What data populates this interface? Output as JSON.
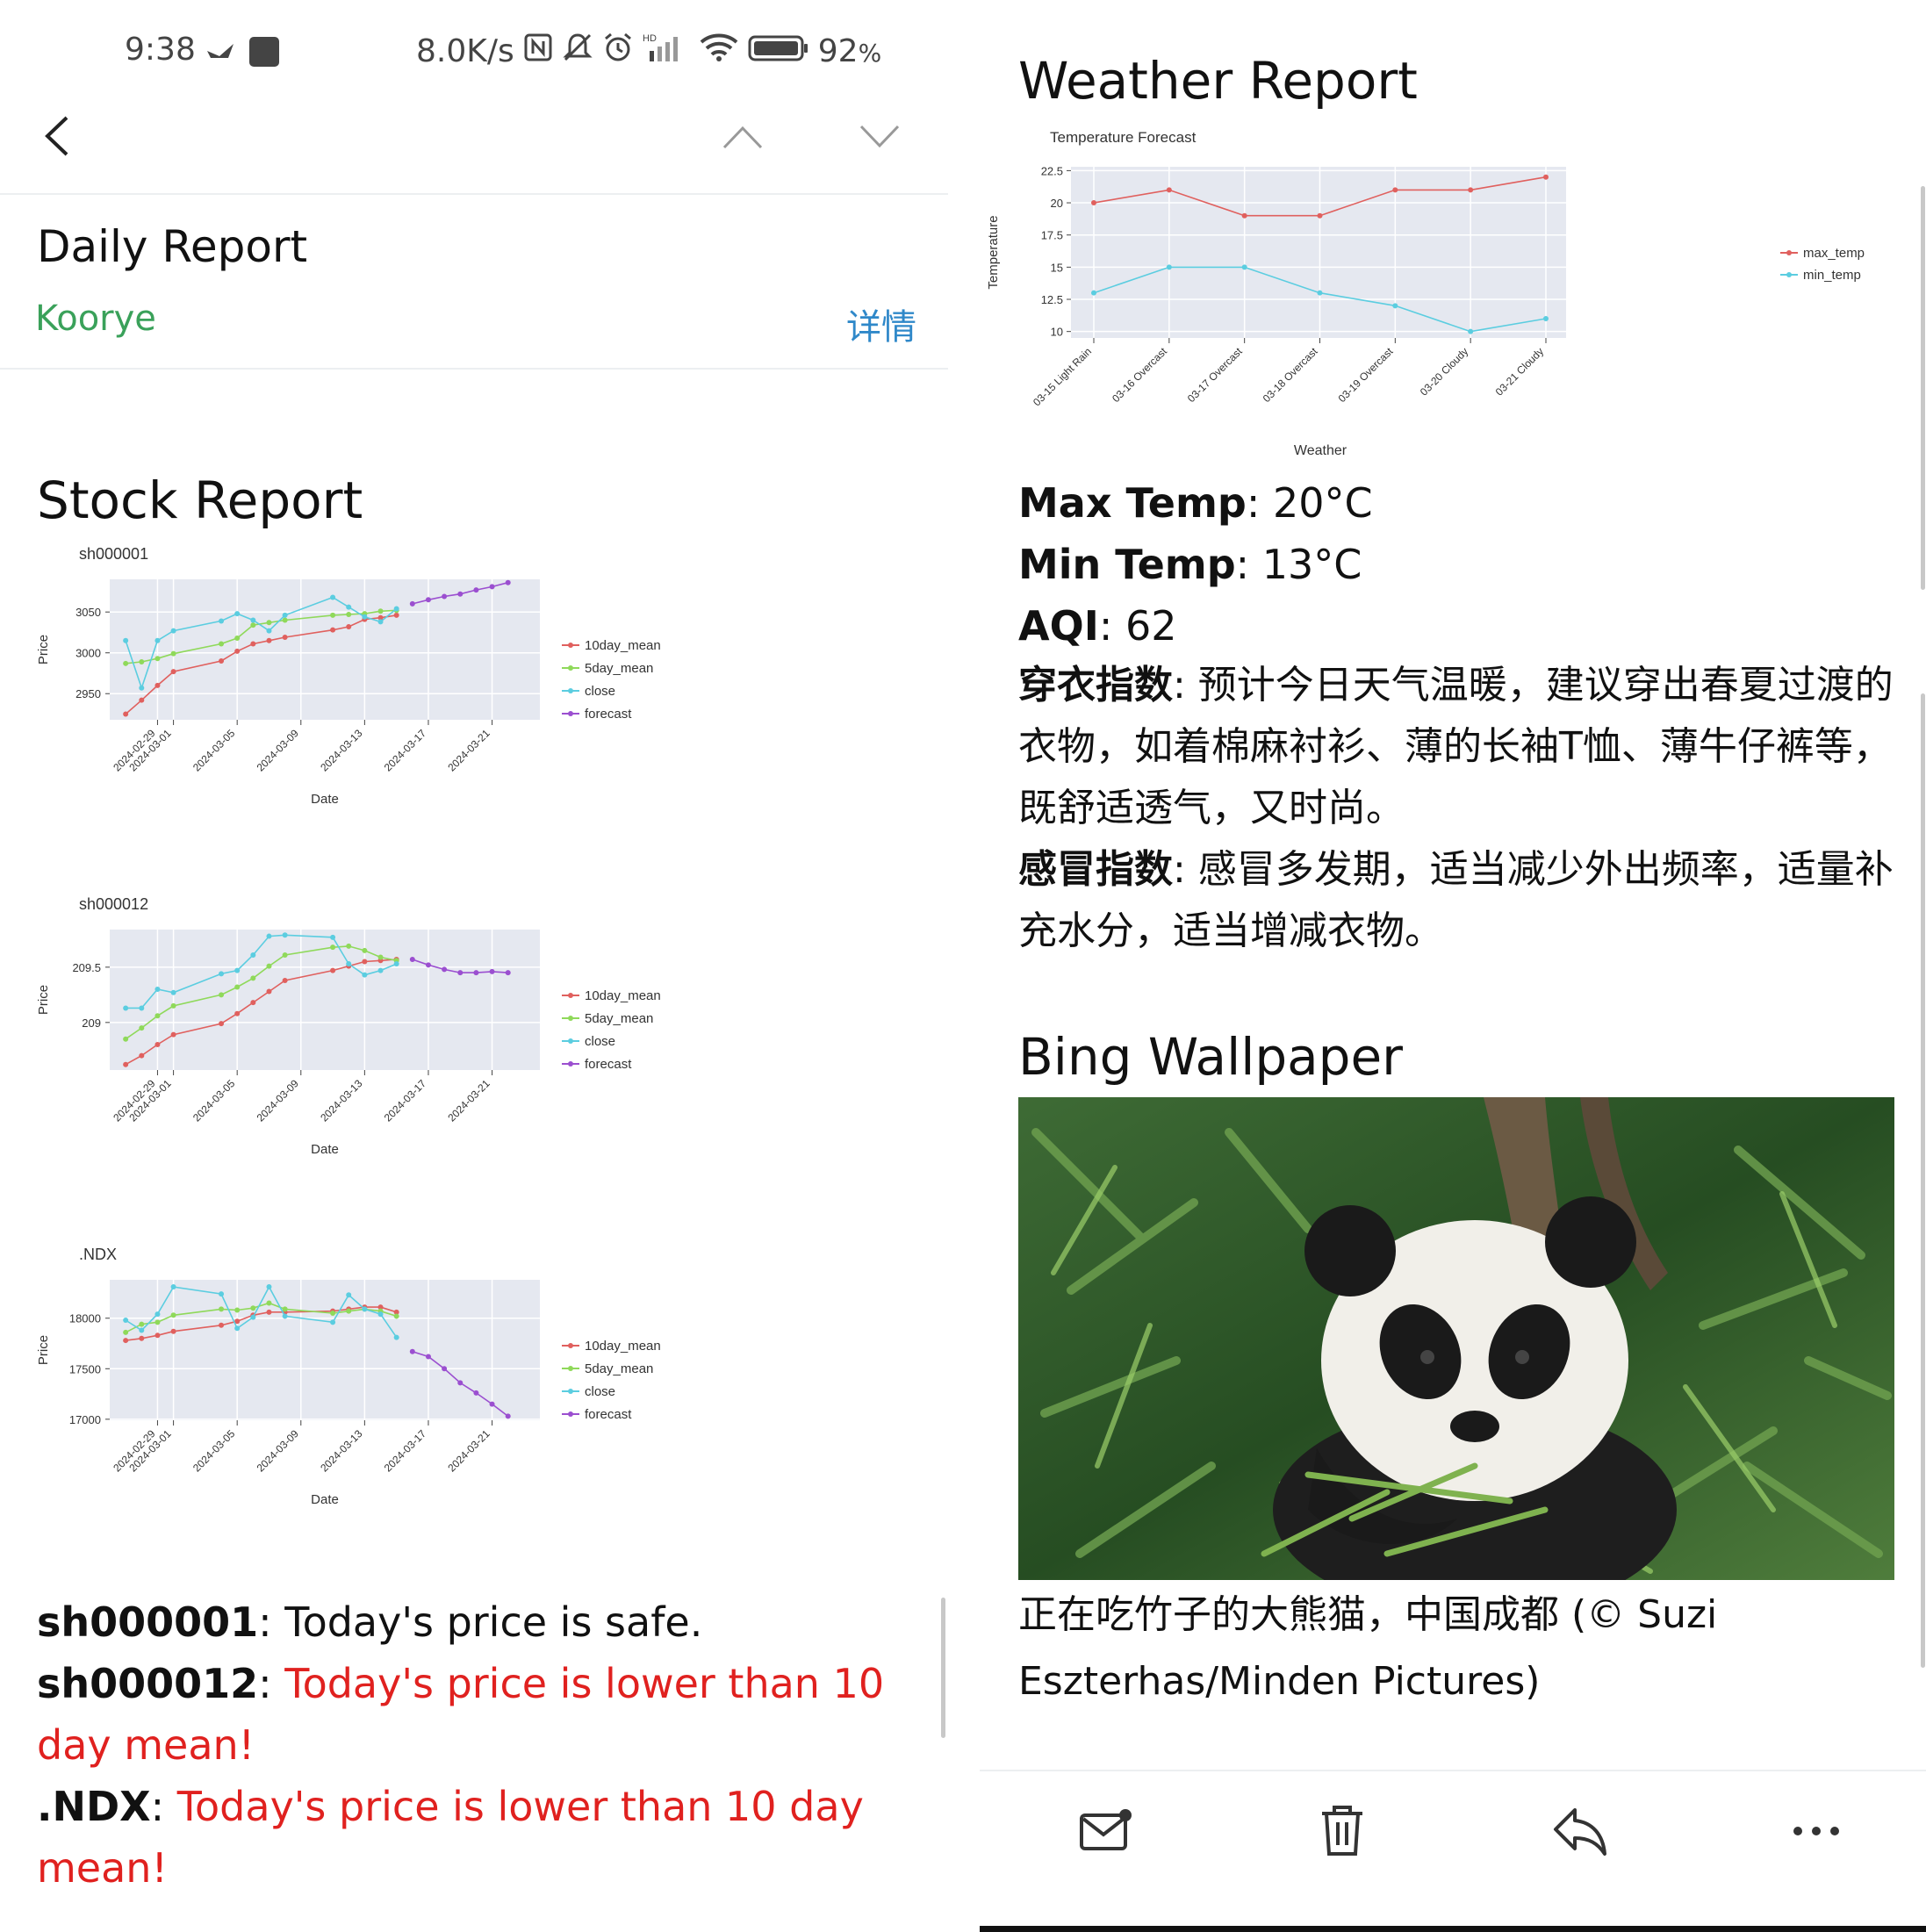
{
  "status_bar": {
    "time": "9:38",
    "speed": "8.0K/s",
    "battery": "92",
    "battery_unit": "%",
    "network": "HD"
  },
  "nav": {
    "back_icon": "chevron-left-icon",
    "prev_icon": "chevron-up-icon",
    "next_icon": "chevron-down-icon"
  },
  "mail": {
    "subject": "Daily Report",
    "sender": "Koorye",
    "details_link": "详情"
  },
  "stock": {
    "section_title": "Stock Report",
    "messages": [
      {
        "symbol": "sh000001",
        "text": "Today's price is safe.",
        "status": "safe"
      },
      {
        "symbol": "sh000012",
        "text": "Today's price is lower than 10 day mean!",
        "status": "warning"
      },
      {
        "symbol": ".NDX",
        "text": "Today's price is lower than 10 day mean!",
        "status": "warning"
      }
    ]
  },
  "weather": {
    "section_title": "Weather Report",
    "max_temp_label": "Max Temp",
    "max_temp_value": ": 20°C",
    "min_temp_label": "Min Temp",
    "min_temp_value": ": 13°C",
    "aqi_label": "AQI",
    "aqi_value": ": 62",
    "dress_label": "穿衣指数",
    "dress_text": ": 预计今日天气温暖，建议穿出春夏过渡的衣物，如着棉麻衬衫、薄的长袖T恤、薄牛仔裤等，既舒适透气，又时尚。",
    "cold_label": "感冒指数",
    "cold_text": ": 感冒多发期，适当减少外出频率，适量补充水分，适当增减衣物。"
  },
  "wallpaper": {
    "section_title": "Bing Wallpaper",
    "caption": "正在吃竹子的大熊猫，中国成都 (© Suzi Eszterhas/Minden Pictures)"
  },
  "toolbar": {
    "icons": [
      "mail-icon",
      "trash-icon",
      "reply-icon",
      "more-icon"
    ]
  },
  "colors": {
    "10day_mean": "#e0605e",
    "5day_mean": "#8fd95a",
    "close": "#5bcde0",
    "forecast": "#9b4fd0",
    "max_temp": "#e0605e",
    "min_temp": "#5bcde0",
    "plot_bg": "#e5e8f0",
    "warning": "#e0211f",
    "sender": "#3aa15a",
    "link": "#2f88c9"
  },
  "chart_data": [
    {
      "type": "line",
      "title": "sh000001",
      "xlabel": "Date",
      "ylabel": "Price",
      "x_ticks": [
        "2024-02-29",
        "2024-03-01",
        "2024-03-05",
        "2024-03-09",
        "2024-03-13",
        "2024-03-17",
        "2024-03-21"
      ],
      "y_ticks": [
        2950,
        3000,
        3050
      ],
      "xlim": [
        "2024-02-26",
        "2024-03-24"
      ],
      "ylim": [
        2918,
        3090
      ],
      "legend": "right",
      "series": [
        {
          "name": "10day_mean",
          "x": [
            "2024-02-27",
            "2024-02-28",
            "2024-02-29",
            "2024-03-01",
            "2024-03-04",
            "2024-03-05",
            "2024-03-06",
            "2024-03-07",
            "2024-03-08",
            "2024-03-11",
            "2024-03-12",
            "2024-03-13",
            "2024-03-14",
            "2024-03-15"
          ],
          "y": [
            2925,
            2942,
            2960,
            2977,
            2990,
            3002,
            3011,
            3015,
            3019,
            3028,
            3032,
            3041,
            3043,
            3046
          ]
        },
        {
          "name": "5day_mean",
          "x": [
            "2024-02-27",
            "2024-02-28",
            "2024-02-29",
            "2024-03-01",
            "2024-03-04",
            "2024-03-05",
            "2024-03-06",
            "2024-03-07",
            "2024-03-08",
            "2024-03-11",
            "2024-03-12",
            "2024-03-13",
            "2024-03-14",
            "2024-03-15"
          ],
          "y": [
            2987,
            2989,
            2993,
            2999,
            3011,
            3018,
            3034,
            3037,
            3040,
            3046,
            3047,
            3048,
            3051,
            3052
          ]
        },
        {
          "name": "close",
          "x": [
            "2024-02-27",
            "2024-02-28",
            "2024-02-29",
            "2024-03-01",
            "2024-03-04",
            "2024-03-05",
            "2024-03-06",
            "2024-03-07",
            "2024-03-08",
            "2024-03-11",
            "2024-03-12",
            "2024-03-13",
            "2024-03-14",
            "2024-03-15"
          ],
          "y": [
            3015,
            2957,
            3015,
            3027,
            3039,
            3048,
            3040,
            3027,
            3046,
            3068,
            3056,
            3044,
            3038,
            3054
          ]
        },
        {
          "name": "forecast",
          "x": [
            "2024-03-16",
            "2024-03-17",
            "2024-03-18",
            "2024-03-19",
            "2024-03-20",
            "2024-03-21",
            "2024-03-22"
          ],
          "y": [
            3060,
            3065,
            3069,
            3072,
            3077,
            3081,
            3086
          ]
        }
      ]
    },
    {
      "type": "line",
      "title": "sh000012",
      "xlabel": "Date",
      "ylabel": "Price",
      "x_ticks": [
        "2024-02-29",
        "2024-03-01",
        "2024-03-05",
        "2024-03-09",
        "2024-03-13",
        "2024-03-17",
        "2024-03-21"
      ],
      "y_ticks": [
        209,
        209.5
      ],
      "xlim": [
        "2024-02-26",
        "2024-03-24"
      ],
      "ylim": [
        208.57,
        209.84
      ],
      "legend": "right",
      "series": [
        {
          "name": "10day_mean",
          "x": [
            "2024-02-27",
            "2024-02-28",
            "2024-02-29",
            "2024-03-01",
            "2024-03-04",
            "2024-03-05",
            "2024-03-06",
            "2024-03-07",
            "2024-03-08",
            "2024-03-11",
            "2024-03-12",
            "2024-03-13",
            "2024-03-14",
            "2024-03-15"
          ],
          "y": [
            208.62,
            208.7,
            208.8,
            208.89,
            208.99,
            209.08,
            209.18,
            209.28,
            209.38,
            209.47,
            209.51,
            209.55,
            209.56,
            209.57
          ]
        },
        {
          "name": "5day_mean",
          "x": [
            "2024-02-27",
            "2024-02-28",
            "2024-02-29",
            "2024-03-01",
            "2024-03-04",
            "2024-03-05",
            "2024-03-06",
            "2024-03-07",
            "2024-03-08",
            "2024-03-11",
            "2024-03-12",
            "2024-03-13",
            "2024-03-14",
            "2024-03-15"
          ],
          "y": [
            208.85,
            208.95,
            209.06,
            209.15,
            209.25,
            209.32,
            209.4,
            209.51,
            209.61,
            209.68,
            209.69,
            209.65,
            209.59,
            209.56
          ]
        },
        {
          "name": "close",
          "x": [
            "2024-02-27",
            "2024-02-28",
            "2024-02-29",
            "2024-03-01",
            "2024-03-04",
            "2024-03-05",
            "2024-03-06",
            "2024-03-07",
            "2024-03-08",
            "2024-03-11",
            "2024-03-12",
            "2024-03-13",
            "2024-03-14",
            "2024-03-15"
          ],
          "y": [
            209.13,
            209.13,
            209.3,
            209.27,
            209.44,
            209.47,
            209.61,
            209.78,
            209.79,
            209.77,
            209.53,
            209.43,
            209.47,
            209.53
          ]
        },
        {
          "name": "forecast",
          "x": [
            "2024-03-16",
            "2024-03-17",
            "2024-03-18",
            "2024-03-19",
            "2024-03-20",
            "2024-03-21",
            "2024-03-22"
          ],
          "y": [
            209.57,
            209.52,
            209.48,
            209.45,
            209.45,
            209.46,
            209.45
          ]
        }
      ]
    },
    {
      "type": "line",
      "title": ".NDX",
      "xlabel": "Date",
      "ylabel": "Price",
      "x_ticks": [
        "2024-02-29",
        "2024-03-01",
        "2024-03-05",
        "2024-03-09",
        "2024-03-13",
        "2024-03-17",
        "2024-03-21"
      ],
      "y_ticks": [
        17000,
        17500,
        18000
      ],
      "xlim": [
        "2024-02-26",
        "2024-03-24"
      ],
      "ylim": [
        16990,
        18380
      ],
      "legend": "right",
      "series": [
        {
          "name": "10day_mean",
          "x": [
            "2024-02-27",
            "2024-02-28",
            "2024-02-29",
            "2024-03-01",
            "2024-03-04",
            "2024-03-05",
            "2024-03-06",
            "2024-03-07",
            "2024-03-08",
            "2024-03-11",
            "2024-03-12",
            "2024-03-13",
            "2024-03-14",
            "2024-03-15"
          ],
          "y": [
            17780,
            17800,
            17830,
            17870,
            17930,
            17970,
            18030,
            18060,
            18060,
            18070,
            18090,
            18110,
            18110,
            18060
          ]
        },
        {
          "name": "5day_mean",
          "x": [
            "2024-02-27",
            "2024-02-28",
            "2024-02-29",
            "2024-03-01",
            "2024-03-04",
            "2024-03-05",
            "2024-03-06",
            "2024-03-07",
            "2024-03-08",
            "2024-03-11",
            "2024-03-12",
            "2024-03-13",
            "2024-03-14",
            "2024-03-15"
          ],
          "y": [
            17860,
            17940,
            17960,
            18030,
            18090,
            18080,
            18100,
            18150,
            18090,
            18050,
            18070,
            18090,
            18070,
            18020
          ]
        },
        {
          "name": "close",
          "x": [
            "2024-02-27",
            "2024-02-28",
            "2024-02-29",
            "2024-03-01",
            "2024-03-04",
            "2024-03-05",
            "2024-03-06",
            "2024-03-07",
            "2024-03-08",
            "2024-03-11",
            "2024-03-12",
            "2024-03-13",
            "2024-03-14",
            "2024-03-15"
          ],
          "y": [
            17980,
            17880,
            18040,
            18310,
            18240,
            17900,
            18010,
            18310,
            18020,
            17960,
            18230,
            18090,
            18040,
            17810
          ]
        },
        {
          "name": "forecast",
          "x": [
            "2024-03-16",
            "2024-03-17",
            "2024-03-18",
            "2024-03-19",
            "2024-03-20",
            "2024-03-21",
            "2024-03-22"
          ],
          "y": [
            17670,
            17620,
            17500,
            17360,
            17260,
            17150,
            17030
          ]
        }
      ]
    },
    {
      "type": "line",
      "title": "Temperature Forecast",
      "xlabel": "Weather",
      "ylabel": "Temperature",
      "categories": [
        "03-15 Light Rain",
        "03-16 Overcast",
        "03-17 Overcast",
        "03-18 Overcast",
        "03-19 Overcast",
        "03-20 Cloudy",
        "03-21 Cloudy"
      ],
      "y_ticks": [
        10,
        12.5,
        15,
        17.5,
        20,
        22.5
      ],
      "ylim": [
        9.5,
        22.8
      ],
      "legend": "right",
      "series": [
        {
          "name": "max_temp",
          "values": [
            20,
            21,
            19,
            19,
            21,
            21,
            22
          ]
        },
        {
          "name": "min_temp",
          "values": [
            13,
            15,
            15,
            13,
            12,
            10,
            11
          ]
        }
      ]
    }
  ]
}
